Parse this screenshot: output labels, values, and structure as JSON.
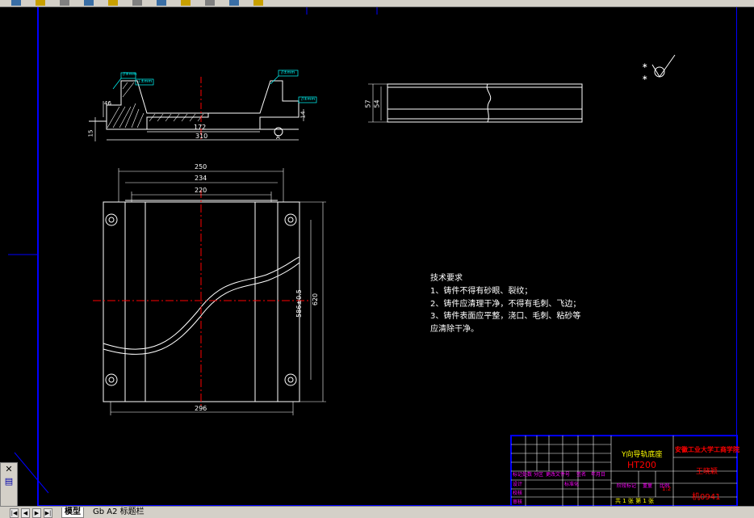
{
  "toolbar": {
    "buttons": [
      "new-icon",
      "open-icon",
      "save-icon",
      "print-icon",
      "undo-icon",
      "redo-icon",
      "pan-icon",
      "zoom-icon",
      "properties-icon",
      "layers-icon",
      "help-icon"
    ]
  },
  "drawing": {
    "section_dims": {
      "w1": "172",
      "w2": "310",
      "h1": "46",
      "h2": "15",
      "h3": "14",
      "callouts": [
        "//±mm",
        "⊥±mm",
        "//±mm",
        "//±mm"
      ],
      "datum": "A"
    },
    "side_dims": {
      "h_outer": "57",
      "h_inner": "54"
    },
    "plan_dims": {
      "w_250": "250",
      "w_234": "234",
      "w_220": "220",
      "w_296": "296",
      "h_inner": "586±0.5",
      "h_outer": "620"
    },
    "roughness_symbols": [
      "∗",
      "∗"
    ],
    "tech_req": {
      "title": "技术要求",
      "lines": [
        "1、铸件不得有砂眼、裂纹；",
        "2、铸件应清理干净，不得有毛刺、飞边；",
        "3、铸件表面应平整，浇口、毛刺、粘砂等",
        "应清除干净。"
      ]
    }
  },
  "title_block": {
    "part_name": "Y向导轨底座",
    "material": "HT200",
    "school": "安徽工业大学工商学院",
    "author": "王晓颖",
    "drawing_no": "机0941",
    "sheet_info": "共 1 张  第 1 张",
    "scale_value": "1:2",
    "headers": [
      "标记",
      "处数",
      "分区",
      "更改文件号",
      "签名",
      "年月日"
    ],
    "header_x": [
      641,
      653,
      667,
      682,
      720,
      738
    ],
    "rows": [
      "设计",
      "校核",
      "审核",
      "工艺"
    ],
    "mid_labels": [
      "标准化"
    ],
    "stage_labels": [
      "阶段标记",
      "重量",
      "比例"
    ],
    "approve_label": "批准"
  },
  "tabs": [
    "模型",
    "Gb A2 标题栏"
  ],
  "palette": [
    "✕",
    "▤"
  ]
}
